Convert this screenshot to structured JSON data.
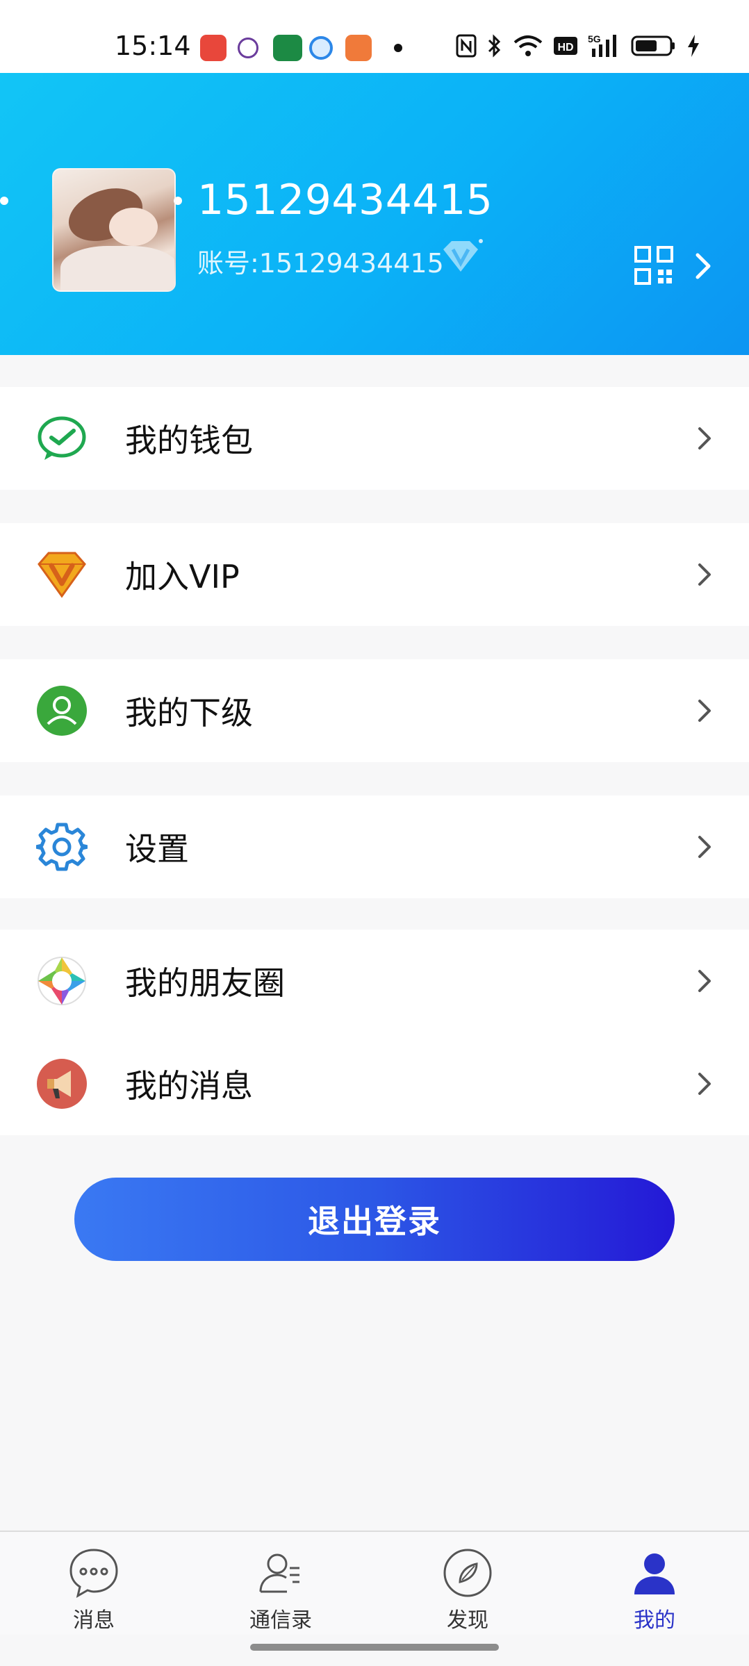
{
  "status_bar": {
    "time": "15:14",
    "network": "5G",
    "hd_badge": "HD"
  },
  "profile": {
    "nickname": "15129434415",
    "account_label": "账号:15129434415",
    "avatar_icon": "avatar-photo",
    "badge_icon": "diamond-icon",
    "qr_icon": "qr-code-icon"
  },
  "menu": {
    "wallet": {
      "label": "我的钱包",
      "icon": "wechat-pay-icon"
    },
    "vip": {
      "label": "加入VIP",
      "icon": "vip-diamond-icon"
    },
    "subordinates": {
      "label": "我的下级",
      "icon": "user-green-icon"
    },
    "settings": {
      "label": "设置",
      "icon": "gear-icon"
    },
    "moments": {
      "label": "我的朋友圈",
      "icon": "aperture-icon"
    },
    "messages": {
      "label": "我的消息",
      "icon": "megaphone-icon"
    }
  },
  "logout_label": "退出登录",
  "tabs": [
    {
      "label": "消息",
      "icon": "chat-bubble-icon",
      "active": false
    },
    {
      "label": "通信录",
      "icon": "contacts-icon",
      "active": false
    },
    {
      "label": "发现",
      "icon": "compass-icon",
      "active": false
    },
    {
      "label": "我的",
      "icon": "person-icon",
      "active": true
    }
  ],
  "colors": {
    "header_start": "#12c5f6",
    "header_end": "#0c95f2",
    "logout_start": "#3a79f3",
    "logout_end": "#2419d6",
    "active_tab": "#2a33c8"
  }
}
